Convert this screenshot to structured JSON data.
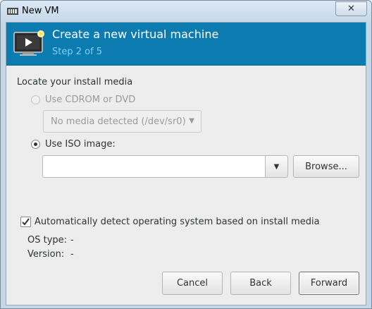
{
  "window": {
    "title": "New VM",
    "close_glyph": "✕",
    "icon": "vm-app-icon"
  },
  "header": {
    "title": "Create a new virtual machine",
    "step": "Step 2 of 5",
    "icon": "monitor-play-icon",
    "bg_color": "#0b7bb0",
    "step_color": "#7fd0f3"
  },
  "media": {
    "section_label": "Locate your install media",
    "cdrom_label": "Use CDROM or DVD",
    "cdrom_selected": false,
    "cdrom_enabled": false,
    "cdrom_combo_value": "No media detected (/dev/sr0)",
    "iso_label": "Use ISO image:",
    "iso_selected": true,
    "iso_path_value": "",
    "browse_label": "Browse..."
  },
  "os_detect": {
    "checkbox_label": "Automatically detect operating system based on install media",
    "checked": true,
    "os_type_label": "OS type:",
    "os_type_value": "-",
    "version_label": "Version:",
    "version_value": "-"
  },
  "buttons": {
    "cancel": "Cancel",
    "back": "Back",
    "forward": "Forward"
  }
}
